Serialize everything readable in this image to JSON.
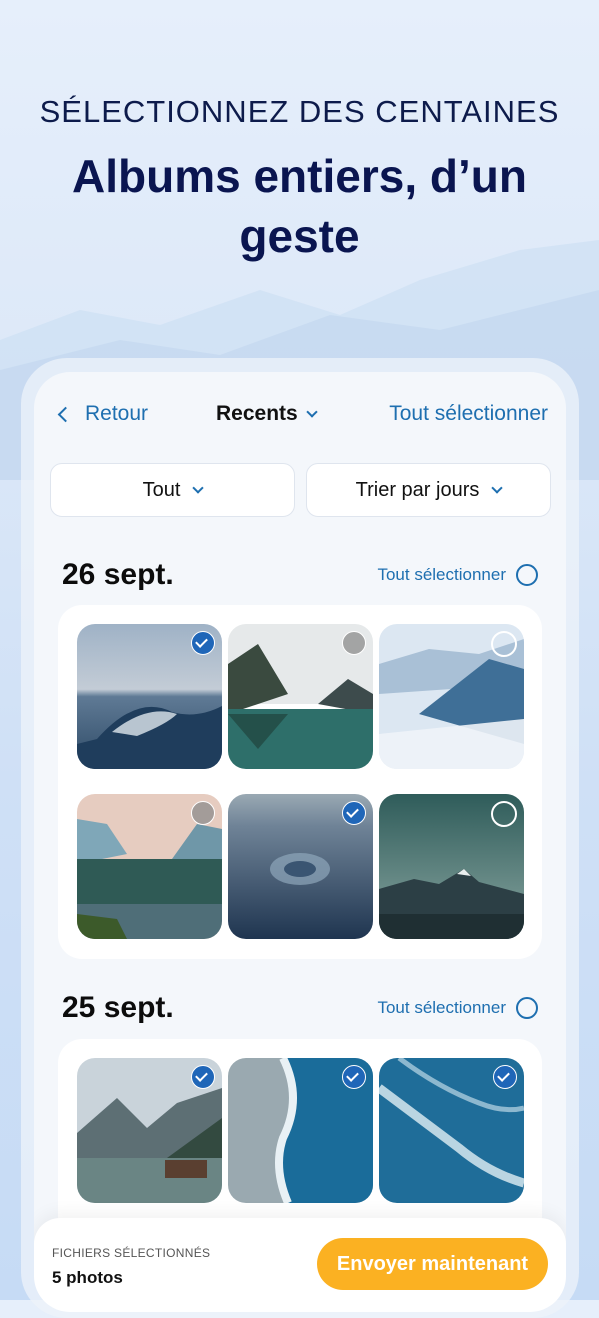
{
  "header": {
    "kicker": "SÉLECTIONNEZ DES CENTAINES",
    "title_line1": "Albums entiers, d’un",
    "title_line2": "geste"
  },
  "nav": {
    "back_label": "Retour",
    "album_title": "Recents",
    "select_all": "Tout sélectionner"
  },
  "filters": {
    "type": "Tout",
    "sort": "Trier par jours"
  },
  "sections": [
    {
      "date": "26 sept.",
      "select_all": "Tout sélectionner",
      "photos": [
        {
          "name": "wave-photo",
          "selected": true
        },
        {
          "name": "lake-mountain-photo",
          "selected": false
        },
        {
          "name": "misty-mountains-photo",
          "selected": false
        },
        {
          "name": "forest-sunset-photo",
          "selected": false
        },
        {
          "name": "water-splash-photo",
          "selected": true
        },
        {
          "name": "snowy-peak-photo",
          "selected": false
        }
      ]
    },
    {
      "date": "25 sept.",
      "select_all": "Tout sélectionner",
      "photos": [
        {
          "name": "alpine-lake-cabin-photo",
          "selected": true
        },
        {
          "name": "aerial-beach-photo",
          "selected": true
        },
        {
          "name": "aerial-waves-photo",
          "selected": true
        }
      ]
    }
  ],
  "bottom_bar": {
    "label": "FICHIERS SÉLECTIONNÉS",
    "count": "5 photos",
    "send_button": "Envoyer maintenant"
  },
  "colors": {
    "accent": "#1e6fb0",
    "check": "#1f66b8",
    "send": "#fbb122",
    "title": "#0a1550"
  }
}
